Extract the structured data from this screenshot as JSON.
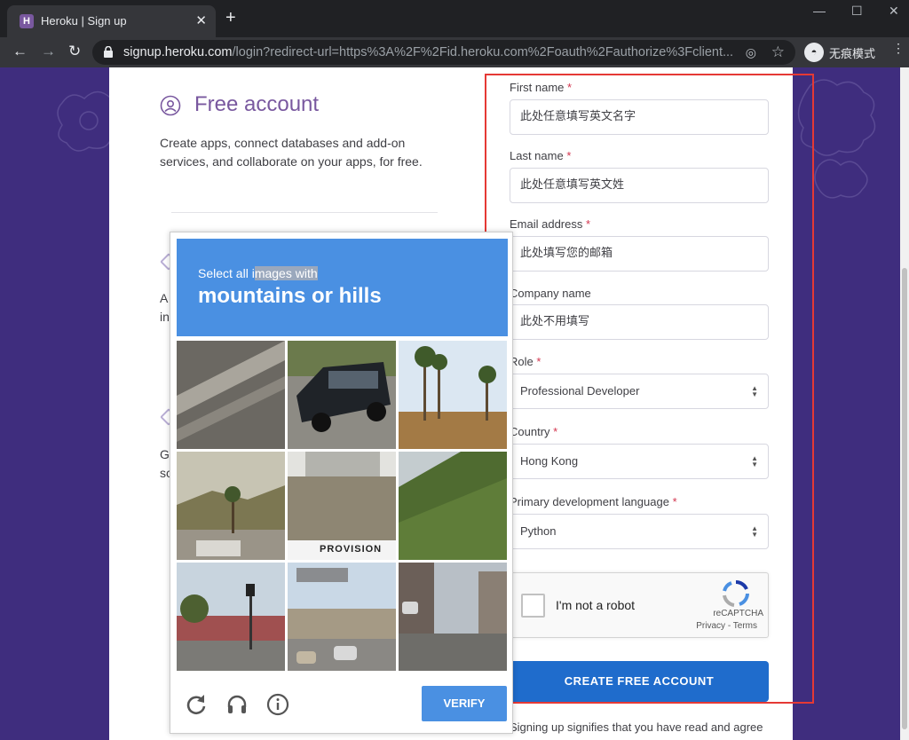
{
  "browser": {
    "tab_title": "Heroku | Sign up",
    "tab_favicon": "H",
    "tab_close": "✕",
    "new_tab": "+",
    "url_host": "signup.heroku.com",
    "url_path": "/login?redirect-url=https%3A%2F%2Fid.heroku.com%2Foauth%2Fauthorize%3Fclient...",
    "incognito_label": "无痕模式"
  },
  "left": {
    "title": "Free account",
    "description": "Create apps, connect databases and add-on services, and collaborate on your apps, for free.",
    "peek": [
      "A",
      "in",
      "G",
      "sc"
    ]
  },
  "form": {
    "first_name_label": "First name",
    "first_name_value": "此处任意填写英文名字",
    "last_name_label": "Last name",
    "last_name_value": "此处任意填写英文姓",
    "email_label": "Email address",
    "email_value": "此处填写您的邮箱",
    "company_label": "Company name",
    "company_value": "此处不用填写",
    "role_label": "Role",
    "role_value": "Professional Developer",
    "country_label": "Country",
    "country_value": "Hong Kong",
    "language_label": "Primary development language",
    "language_value": "Python",
    "required_mark": "*",
    "submit_label": "CREATE FREE ACCOUNT",
    "terms_text": "Signing up signifies that you have read and agree"
  },
  "recaptcha": {
    "label": "I'm not a robot",
    "brand": "reCAPTCHA",
    "privacy": "Privacy",
    "separator": " - ",
    "terms": "Terms"
  },
  "challenge": {
    "prompt_pre": "Select all i",
    "prompt_highlight": "mages with",
    "target": "mountains or hills",
    "verify_label": "VERIFY",
    "truck_text": "PROVISION"
  },
  "colors": {
    "heroku_purple": "#79589f",
    "page_bg": "#3f2d7e",
    "button_blue": "#1f6ccc",
    "captcha_blue": "#4a90e2",
    "annotation_red": "#e53935"
  }
}
